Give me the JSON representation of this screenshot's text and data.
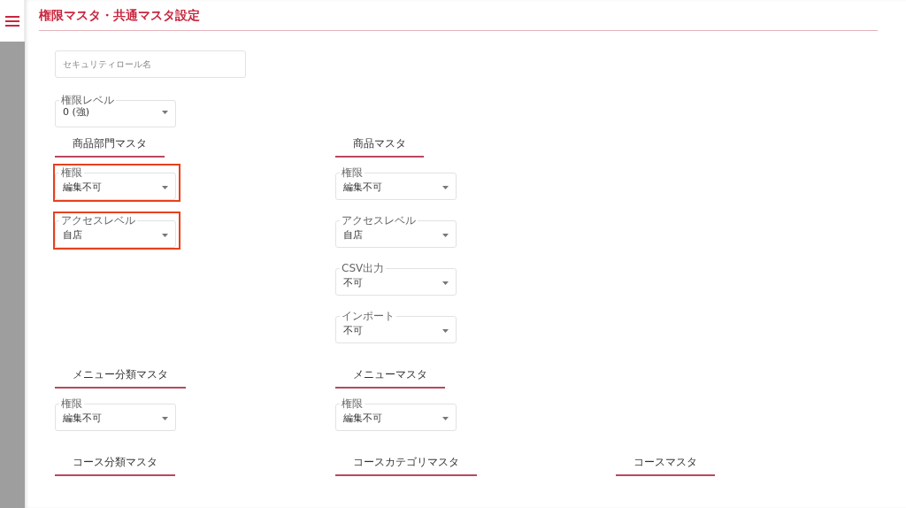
{
  "title": "権限マスタ・共通マスタ設定",
  "role_name": {
    "placeholder": "セキュリティロール名"
  },
  "permission_level": {
    "label": "権限レベル",
    "value": "0 (強)"
  },
  "section_rows": [
    [
      {
        "title": "商品部門マスタ",
        "fields": [
          {
            "label": "権限",
            "value": "編集不可",
            "highlighted": true
          },
          {
            "label": "アクセスレベル",
            "value": "自店",
            "highlighted": true
          }
        ]
      },
      {
        "title": "商品マスタ",
        "fields": [
          {
            "label": "権限",
            "value": "編集不可",
            "highlighted": false
          },
          {
            "label": "アクセスレベル",
            "value": "自店",
            "highlighted": false
          },
          {
            "label": "CSV出力",
            "value": "不可",
            "highlighted": false
          },
          {
            "label": "インポート",
            "value": "不可",
            "highlighted": false
          }
        ]
      }
    ],
    [
      {
        "title": "メニュー分類マスタ",
        "fields": [
          {
            "label": "権限",
            "value": "編集不可",
            "highlighted": false
          }
        ]
      },
      {
        "title": "メニューマスタ",
        "fields": [
          {
            "label": "権限",
            "value": "編集不可",
            "highlighted": false
          }
        ]
      }
    ],
    [
      {
        "title": "コース分類マスタ"
      },
      {
        "title": "コースカテゴリマスタ"
      },
      {
        "title": "コースマスタ"
      }
    ]
  ]
}
